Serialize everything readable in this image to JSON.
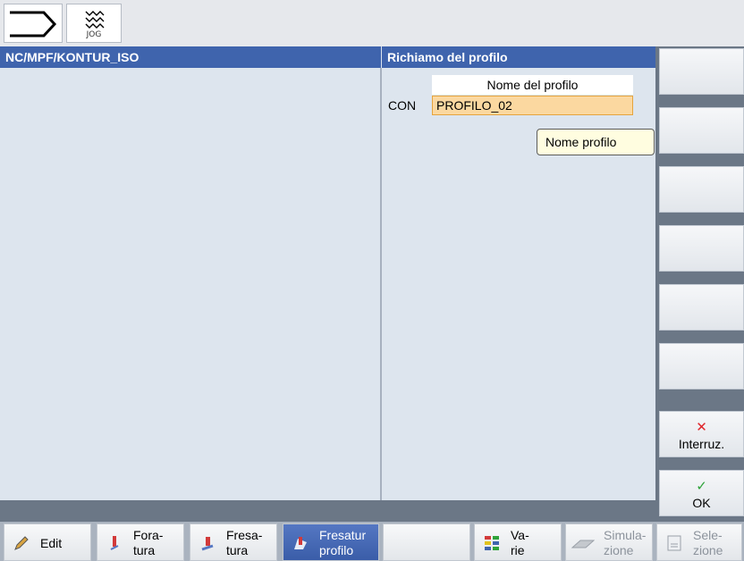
{
  "mode": {
    "jog_label": "JOG"
  },
  "header": {
    "path": "NC/MPF/KONTUR_ISO",
    "dialog_title": "Richiamo del profilo"
  },
  "form": {
    "column_header": "Nome del profilo",
    "field_label": "CON",
    "field_value": "PROFILO_02",
    "tooltip": "Nome profilo"
  },
  "right_softkeys": {
    "cancel_label": "Interruz.",
    "ok_label": "OK"
  },
  "bottom_softkeys": {
    "edit": "Edit",
    "drilling": [
      "Fora-",
      "tura"
    ],
    "milling": [
      "Fresa-",
      "tura"
    ],
    "contour_milling": [
      "Fresatur",
      "profilo"
    ],
    "misc": [
      "Va-",
      "rie"
    ],
    "simulation": [
      "Simula-",
      "zione"
    ],
    "selection": [
      "Sele-",
      "zione"
    ]
  },
  "colors": {
    "header_blue": "#3f64ad",
    "input_orange": "#fbd8a0",
    "cancel_red": "#e0262b",
    "ok_green": "#2fa33a"
  }
}
